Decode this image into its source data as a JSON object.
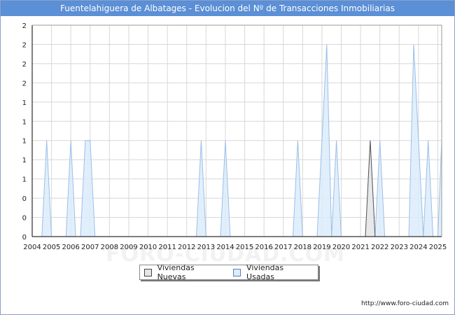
{
  "title": "Fuentelahiguera de Albatages - Evolucion del Nº de Transacciones Inmobiliarias",
  "source": "http://www.foro-ciudad.com",
  "watermark": "FORO-CIUDAD.COM",
  "colors": {
    "title_bg": "#5b8fd6",
    "nuevas_fill": "#e6e6e6",
    "nuevas_line": "#555555",
    "usadas_fill": "#dcecfb",
    "usadas_line": "#9cbfe8",
    "grid": "#d8d8d8"
  },
  "chart_data": {
    "type": "area",
    "title": "Fuentelahiguera de Albatages - Evolucion del Nº de Transacciones Inmobiliarias",
    "xlabel": "",
    "ylabel": "",
    "x_range": [
      2004,
      2025.2
    ],
    "ylim": [
      0,
      2.2
    ],
    "grid": true,
    "legend_position": "bottom-center",
    "x_tick_labels": [
      "2004",
      "2005",
      "2006",
      "2007",
      "2008",
      "2009",
      "2010",
      "2011",
      "2012",
      "2013",
      "2014",
      "2015",
      "2016",
      "2017",
      "2018",
      "2019",
      "2020",
      "2021",
      "2022",
      "2023",
      "2024",
      "2025"
    ],
    "y_tick_labels": [
      "0",
      "0",
      "0",
      "1",
      "1",
      "1",
      "1",
      "1",
      "2",
      "2",
      "2",
      "2"
    ],
    "series": [
      {
        "name": "Viviendas Nuevas",
        "points": [
          [
            2021.25,
            0
          ],
          [
            2021.5,
            1
          ],
          [
            2021.75,
            0
          ]
        ]
      },
      {
        "name": "Viviendas Usadas",
        "points": [
          [
            2004.5,
            0
          ],
          [
            2004.75,
            1
          ],
          [
            2005,
            0
          ],
          [
            2005.75,
            0
          ],
          [
            2006,
            1
          ],
          [
            2006.25,
            0
          ],
          [
            2006.5,
            0
          ],
          [
            2006.75,
            1
          ],
          [
            2007,
            1
          ],
          [
            2007.25,
            0
          ],
          [
            2012.5,
            0
          ],
          [
            2012.75,
            1
          ],
          [
            2013,
            0
          ],
          [
            2013.75,
            0
          ],
          [
            2014,
            1
          ],
          [
            2014.25,
            0
          ],
          [
            2017.5,
            0
          ],
          [
            2017.75,
            1
          ],
          [
            2018,
            0
          ],
          [
            2018.75,
            0
          ],
          [
            2019,
            1
          ],
          [
            2019.25,
            2
          ],
          [
            2019.5,
            0
          ],
          [
            2019.75,
            1
          ],
          [
            2020,
            0
          ],
          [
            2021.25,
            0
          ],
          [
            2021.5,
            1
          ],
          [
            2021.75,
            0
          ],
          [
            2022,
            1
          ],
          [
            2022.25,
            0
          ],
          [
            2023.5,
            0
          ],
          [
            2023.75,
            2
          ],
          [
            2024,
            1
          ],
          [
            2024.25,
            0
          ],
          [
            2024.5,
            1
          ],
          [
            2024.75,
            0
          ],
          [
            2025,
            0
          ],
          [
            2025.2,
            1
          ]
        ]
      }
    ]
  }
}
